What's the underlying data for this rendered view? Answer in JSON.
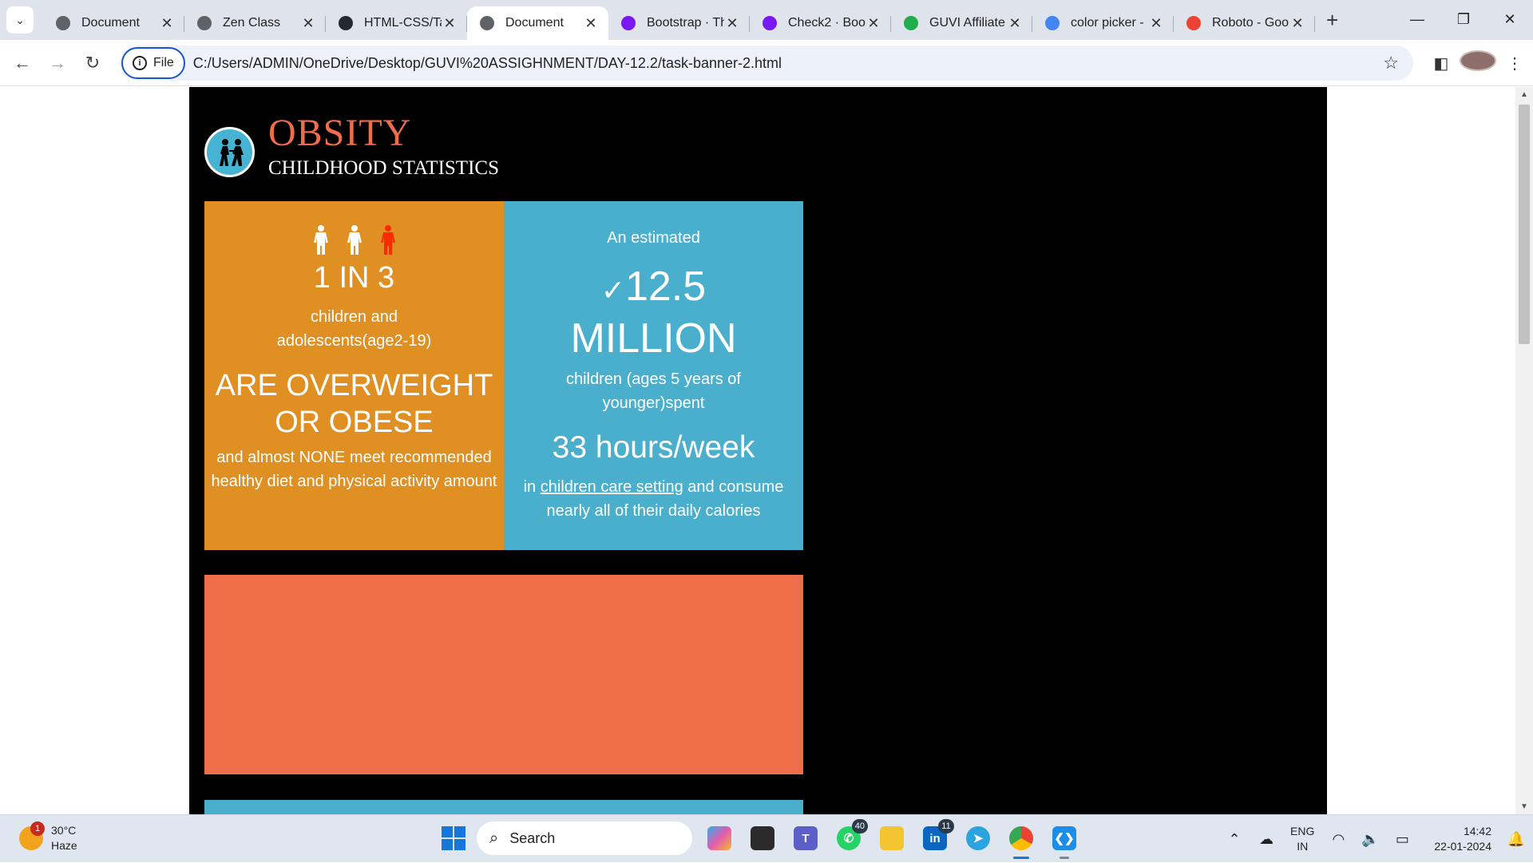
{
  "browser": {
    "tabs": [
      {
        "title": "Document",
        "icon": "globe-icon",
        "fav_color": "#5f6368",
        "active": false
      },
      {
        "title": "Zen Class",
        "icon": "zen-class-icon",
        "fav_color": "#5f6368",
        "active": false
      },
      {
        "title": "HTML-CSS/Ta",
        "icon": "github-icon",
        "fav_color": "#24292f",
        "active": false
      },
      {
        "title": "Document",
        "icon": "globe-icon",
        "fav_color": "#5f6368",
        "active": true
      },
      {
        "title": "Bootstrap · Th",
        "icon": "bootstrap-icon",
        "fav_color": "#7a18f5",
        "active": false
      },
      {
        "title": "Check2 · Boo",
        "icon": "bootstrap-icon",
        "fav_color": "#7a18f5",
        "active": false
      },
      {
        "title": "GUVI Affiliate",
        "icon": "guvi-icon",
        "fav_color": "#1fae4b",
        "active": false
      },
      {
        "title": "color picker -",
        "icon": "google-icon",
        "fav_color": "#4285f4",
        "active": false
      },
      {
        "title": "Roboto - Goo",
        "icon": "google-fonts-icon",
        "fav_color": "#ea4335",
        "active": false
      }
    ],
    "file_chip": "File",
    "url": "C:/Users/ADMIN/OneDrive/Desktop/GUVI%20ASSIGHNMENT/DAY-12.2/task-banner-2.html"
  },
  "page": {
    "brand_title": "OBSITY",
    "brand_subtitle": "CHILDHOOD STATISTICS",
    "orange_card": {
      "stat": "1 IN 3",
      "line1": "children and adolescents(age2-19)",
      "headline": "ARE OVERWEIGHT OR OBESE",
      "line2": "and almost NONE meet recommended healthy diet and physical activity amount"
    },
    "blue_card": {
      "intro": "An estimated",
      "check": "✓",
      "number": "12.5",
      "unit": "MILLION",
      "line1": "children (ages 5 years of younger)spent",
      "hours": "33 hours/week",
      "line2_pre": "in",
      "line2_link": "children care setting",
      "line2_post": "and consume nearly all of their daily calories"
    },
    "colors": {
      "banner_bg": "#000000",
      "orange": "#e08f23",
      "blue": "#4aafcd",
      "coral": "#ef6e4a",
      "title": "#ef6e49",
      "highlight_person": "#ff2a00"
    }
  },
  "taskbar": {
    "weather_temp": "30°C",
    "weather_desc": "Haze",
    "weather_badge": "1",
    "search_placeholder": "Search",
    "whatsapp_badge": "40",
    "linkedin_badge": "11",
    "lang_top": "ENG",
    "lang_bottom": "IN",
    "time": "14:42",
    "date": "22-01-2024"
  }
}
